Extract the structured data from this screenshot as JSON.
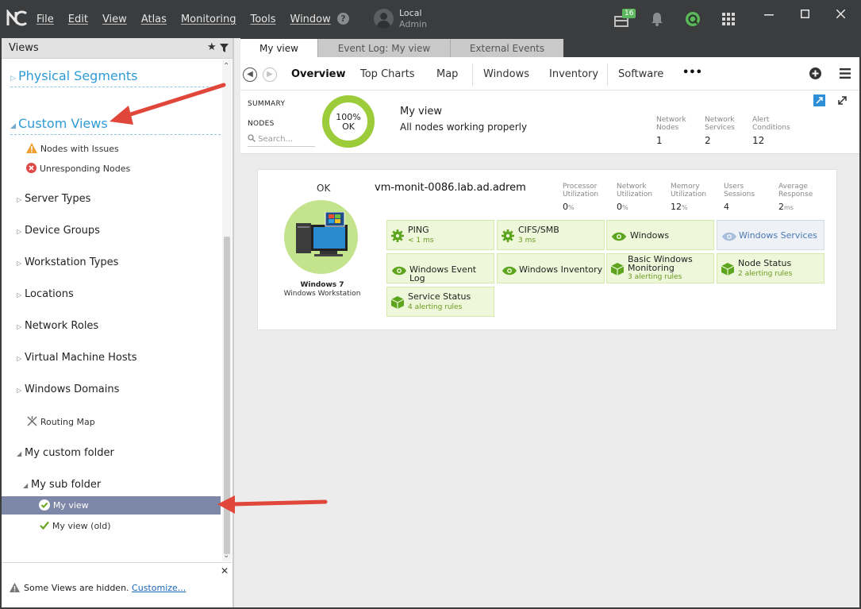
{
  "titlebar": {
    "menu": [
      "File",
      "Edit",
      "View",
      "Atlas",
      "Monitoring",
      "Tools",
      "Window"
    ],
    "help": "?",
    "user_name": "Local",
    "user_role": "Admin",
    "notification_count": "16"
  },
  "views_panel": {
    "title": "Views",
    "physical_segments": "Physical Segments",
    "custom_views": "Custom Views",
    "nodes_with_issues": "Nodes with Issues",
    "unresponding_nodes": "Unresponding Nodes",
    "folders": [
      "Server Types",
      "Device Groups",
      "Workstation Types",
      "Locations",
      "Network Roles",
      "Virtual Machine Hosts",
      "Windows Domains"
    ],
    "routing_map": "Routing Map",
    "my_custom_folder": "My custom folder",
    "my_sub_folder": "My sub folder",
    "my_view": "My view",
    "my_view_old": "My view (old)",
    "footer_msg": "Some Views are hidden.",
    "footer_link": "Customize..."
  },
  "tabs": [
    "My view",
    "Event Log: My view",
    "External Events"
  ],
  "toolbar": {
    "items": [
      "Overview",
      "Top Charts",
      "Map",
      "Windows",
      "Inventory",
      "Software"
    ],
    "more": "•••"
  },
  "summary": {
    "label_summary": "SUMMARY",
    "label_nodes": "NODES",
    "search_placeholder": "Search...",
    "percent": "100%",
    "status": "OK",
    "title": "My view",
    "subtitle": "All nodes working properly",
    "stats": [
      {
        "label1": "Network",
        "label2": "Nodes",
        "value": "1"
      },
      {
        "label1": "Network",
        "label2": "Services",
        "value": "2"
      },
      {
        "label1": "Alert",
        "label2": "Conditions",
        "value": "12"
      }
    ]
  },
  "node": {
    "status": "OK",
    "hostname": "vm-monit-0086.lab.ad.adrem",
    "os": "Windows 7",
    "type": "Windows Workstation",
    "metrics": [
      {
        "l1": "Processor",
        "l2": "Utilization",
        "value": "0",
        "unit": "%"
      },
      {
        "l1": "Network",
        "l2": "Utilization",
        "value": "0",
        "unit": "%"
      },
      {
        "l1": "Memory",
        "l2": "Utilization",
        "value": "12",
        "unit": "%"
      },
      {
        "l1": "Users",
        "l2": "Sessions",
        "value": "4",
        "unit": ""
      },
      {
        "l1": "Average",
        "l2": "Response",
        "value": "2",
        "unit": "ms"
      }
    ],
    "monitors": [
      {
        "title": "PING",
        "sub": "< 1 ms"
      },
      {
        "title": "CIFS/SMB",
        "sub": "3 ms"
      },
      {
        "title": "Windows",
        "sub": ""
      },
      {
        "title": "Windows Services",
        "sub": ""
      },
      {
        "title": "Windows Event Log",
        "sub": ""
      },
      {
        "title": "Windows Inventory",
        "sub": ""
      },
      {
        "title": "Basic Windows",
        "title2": "Monitoring",
        "sub": "3 alerting rules"
      },
      {
        "title": "Node Status",
        "sub": "2 alerting rules"
      },
      {
        "title": "Service Status",
        "sub": "4 alerting rules"
      }
    ]
  },
  "colors": {
    "accent_blue": "#2e9bd6",
    "ok_green": "#9ccc3a",
    "selection": "#7d87a7",
    "annotation_arrow": "#e0463a"
  }
}
